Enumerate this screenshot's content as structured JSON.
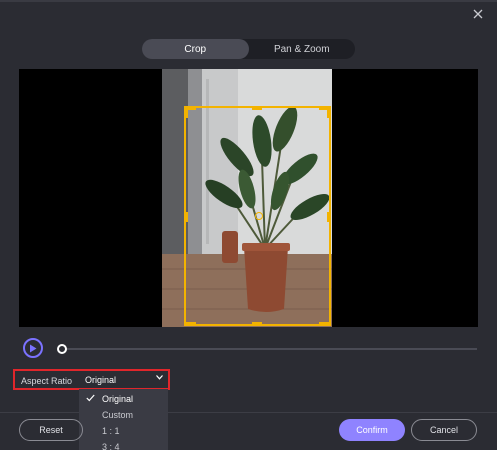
{
  "tabs": [
    {
      "label": "Crop",
      "active": true
    },
    {
      "label": "Pan & Zoom",
      "active": false
    }
  ],
  "aspect_ratio": {
    "label": "Aspect Ratio",
    "selected": "Original",
    "options": [
      "Original",
      "Custom",
      "1 : 1",
      "3 : 4"
    ]
  },
  "buttons": {
    "reset": "Reset",
    "confirm": "Confirm",
    "cancel": "Cancel"
  },
  "playback": {
    "position": 0
  },
  "icons": {
    "close": "close-icon",
    "play": "play-icon",
    "chevron": "chevron-down-icon",
    "check": "check-icon"
  },
  "colors": {
    "background": "#2b2c33",
    "accent": "#8f83ff",
    "crop_frame": "#f3b300",
    "highlight_box": "#e0262b"
  }
}
